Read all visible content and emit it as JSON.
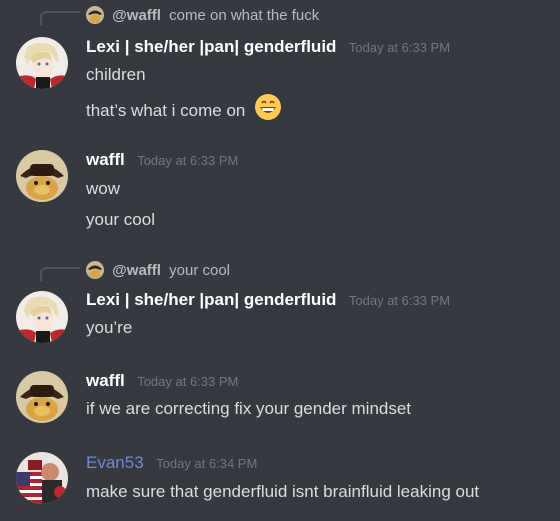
{
  "messages": [
    {
      "reply": {
        "user": "@waffl",
        "text": "come on what the fuck"
      },
      "username": "Lexi | she/her |pan| genderfluid",
      "timestamp": "Today at 6:33 PM",
      "lines": [
        "children",
        "that’s what i come on"
      ],
      "emoji": "grinning-face-emoji"
    },
    {
      "username": "waffl",
      "timestamp": "Today at 6:33 PM",
      "lines": [
        "wow",
        "your cool"
      ]
    },
    {
      "reply": {
        "user": "@waffl",
        "text": "your cool"
      },
      "username": "Lexi | she/her |pan| genderfluid",
      "timestamp": "Today at 6:33 PM",
      "lines": [
        "you’re"
      ]
    },
    {
      "username": "waffl",
      "timestamp": "Today at 6:33 PM",
      "lines": [
        "if we are correcting fix your gender mindset"
      ]
    },
    {
      "username": "Evan53",
      "username_color": "#7289da",
      "timestamp": "Today at 6:34 PM",
      "lines": [
        "make sure that genderfluid isnt brainfluid leaking out"
      ]
    }
  ],
  "colors": {
    "background": "#36393f",
    "text": "#dcddde",
    "timestamp": "#72767d",
    "username": "#ffffff",
    "reply_text": "#b9bbbe",
    "reply_spine": "#4f545c"
  }
}
